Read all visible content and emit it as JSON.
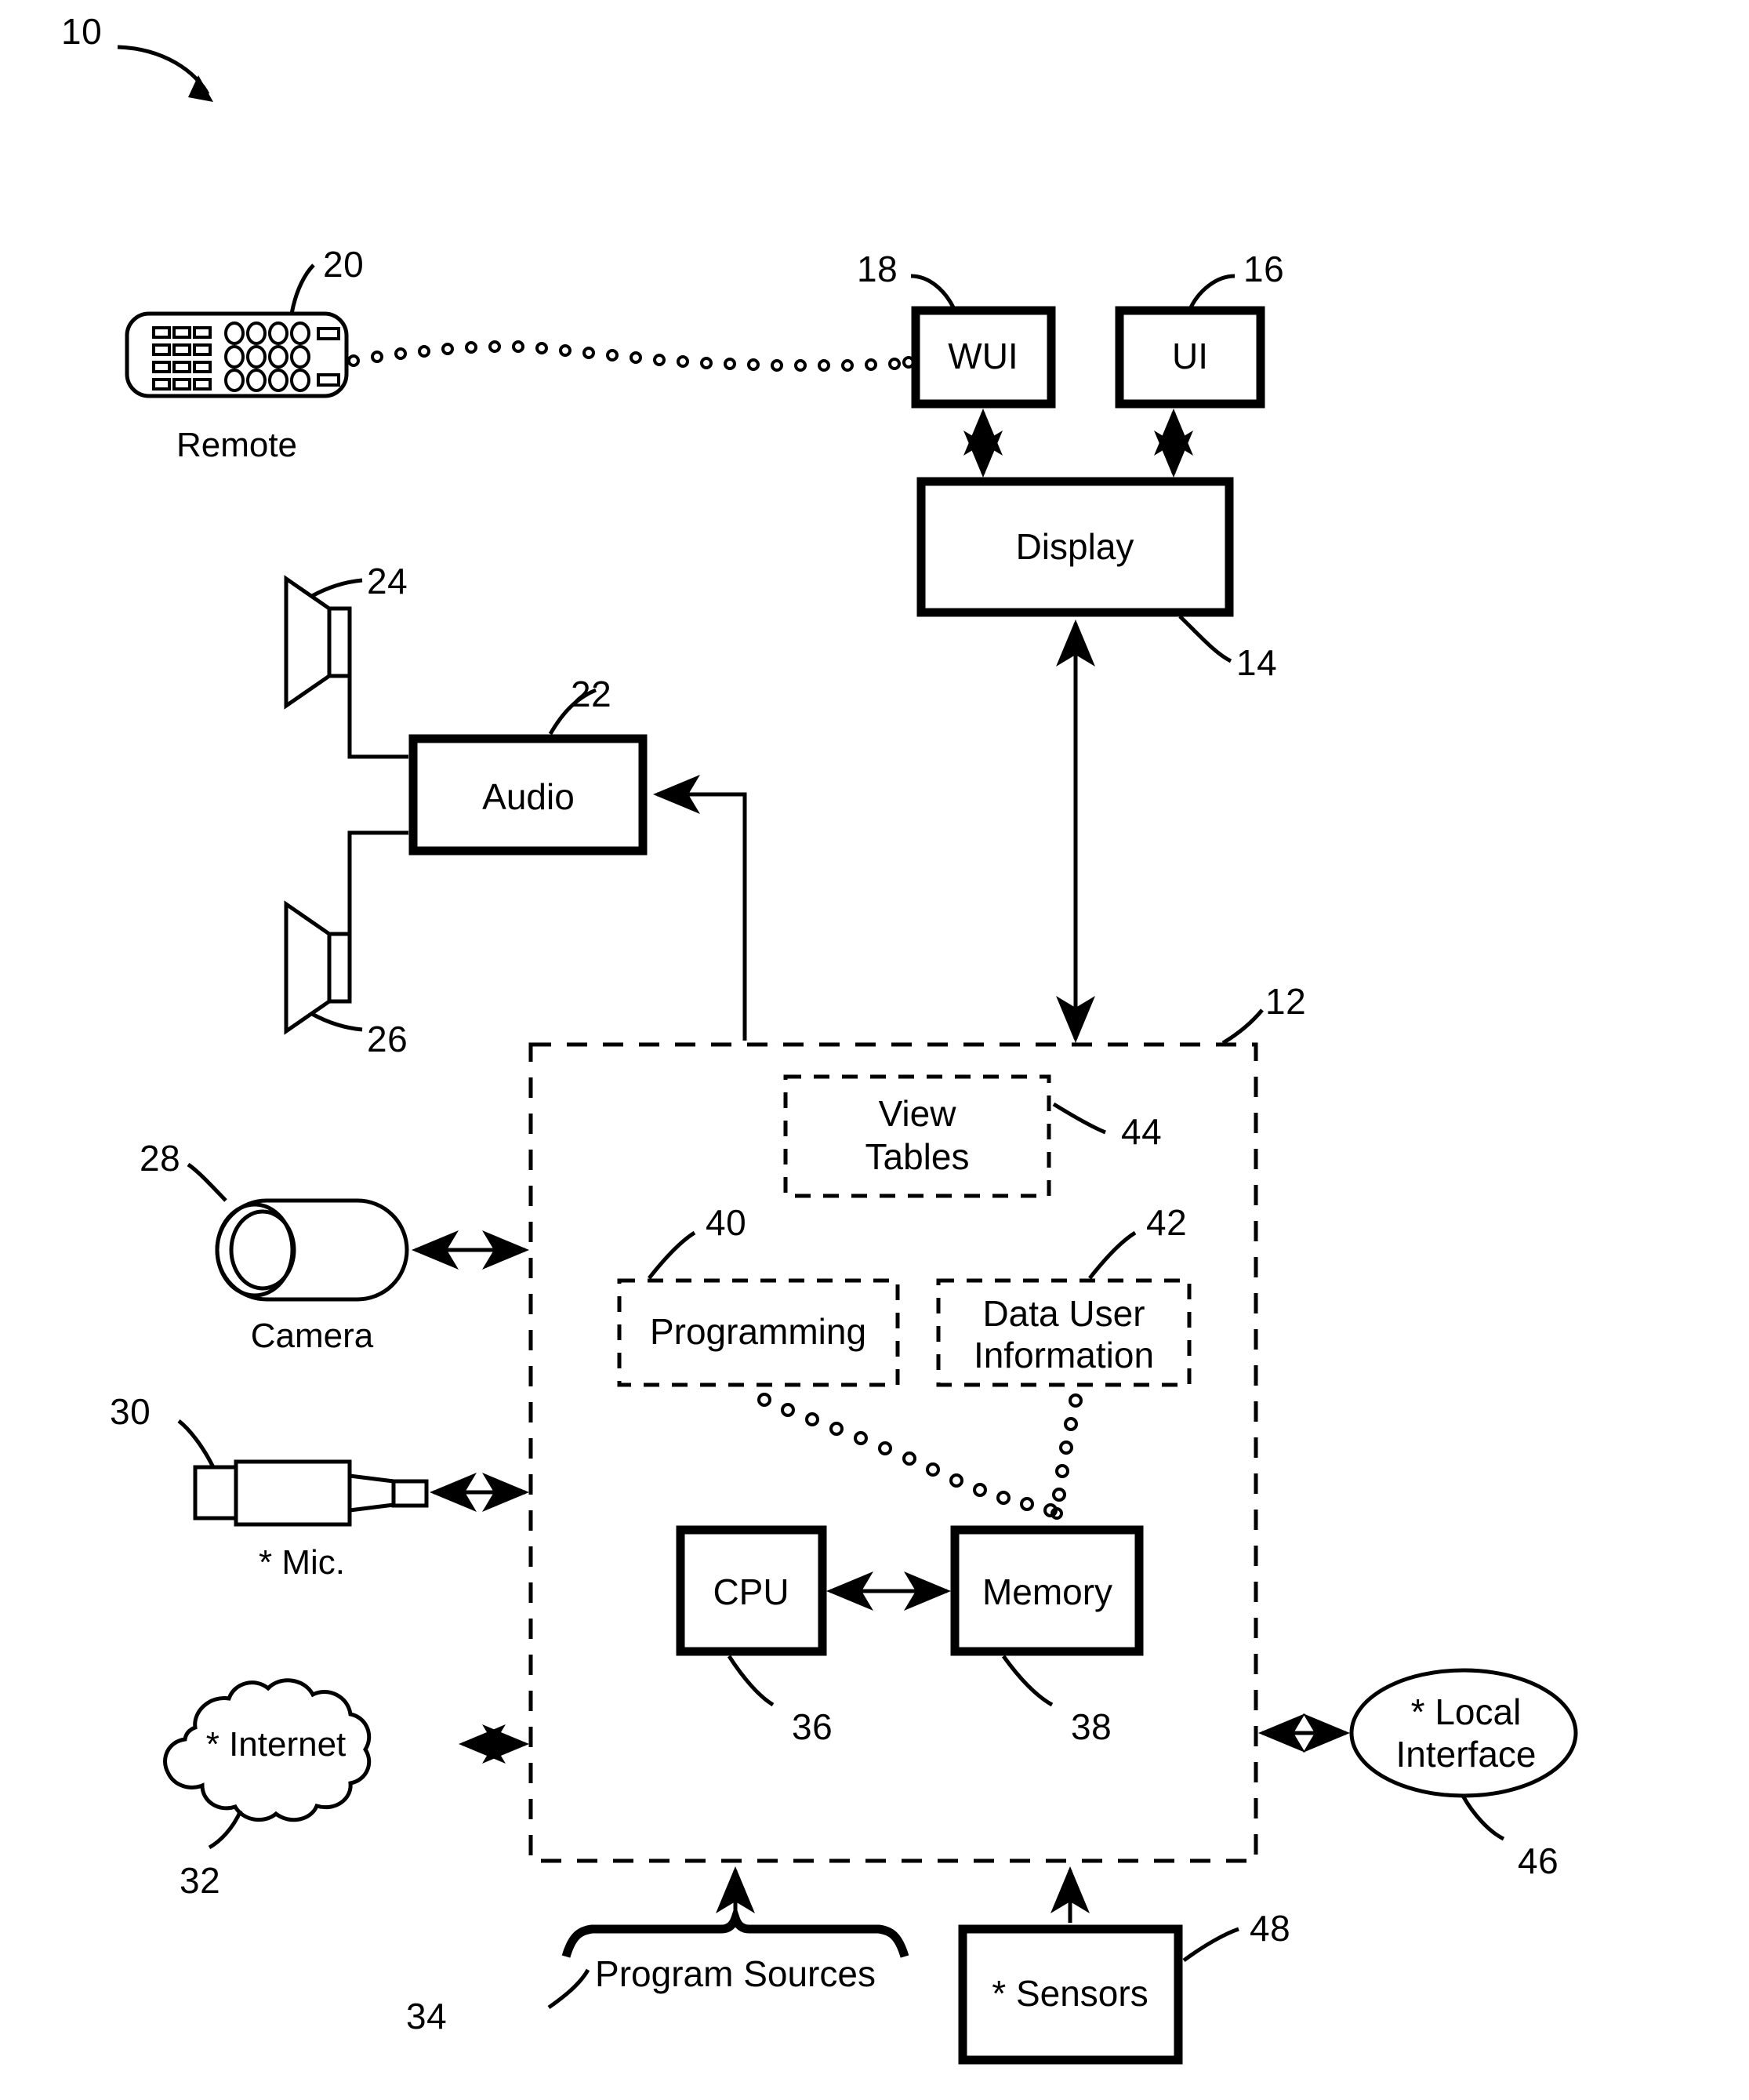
{
  "figure": {
    "type": "patent-block-diagram",
    "root_reference": "10"
  },
  "blocks": {
    "wui": {
      "label": "WUI",
      "ref": "18"
    },
    "ui": {
      "label": "UI",
      "ref": "16"
    },
    "display": {
      "label": "Display",
      "ref": "14"
    },
    "audio": {
      "label": "Audio",
      "ref": "22"
    },
    "speaker_top": {
      "label": "",
      "ref": "24"
    },
    "speaker_bottom": {
      "label": "",
      "ref": "26"
    },
    "remote": {
      "label": "Remote",
      "ref": "20"
    },
    "camera": {
      "label": "Camera",
      "ref": "28"
    },
    "mic": {
      "label": "* Mic.",
      "ref": "30"
    },
    "internet": {
      "label": "* Internet",
      "ref": "32"
    },
    "program_sources": {
      "label": "Program Sources",
      "ref": "34"
    },
    "sensors": {
      "label": "* Sensors",
      "ref": "48"
    },
    "local_interface": {
      "label": "* Local\nInterface",
      "ref": "46"
    },
    "controller": {
      "label": "",
      "ref": "12"
    },
    "cpu": {
      "label": "CPU",
      "ref": "36"
    },
    "memory": {
      "label": "Memory",
      "ref": "38"
    },
    "view_tables": {
      "label": "View\nTables",
      "ref": "44"
    },
    "programming": {
      "label": "Programming",
      "ref": "40"
    },
    "data_user_information": {
      "label": "Data User\nInformation",
      "ref": "42"
    }
  },
  "local_interface_lines": {
    "line1": "* Local",
    "line2": "Interface"
  },
  "view_tables_lines": {
    "line1": "View",
    "line2": "Tables"
  },
  "data_user_lines": {
    "line1": "Data User",
    "line2": "Information"
  },
  "colors": {
    "stroke": "#000000",
    "background": "#ffffff"
  }
}
